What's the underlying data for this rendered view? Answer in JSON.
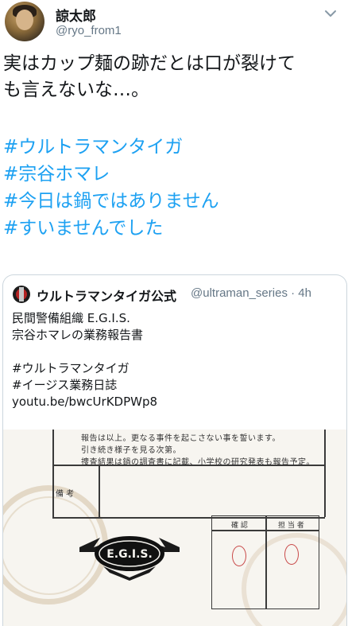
{
  "author": {
    "name": "諒太郎",
    "handle": "@ryo_from1"
  },
  "tweet": {
    "lines": [
      "実はカップ麺の跡だとは口が裂けて",
      "も言えないな…。"
    ],
    "hashtags": [
      "#ウルトラマンタイガ",
      "#宗谷ホマレ",
      "#今日は鍋ではありません",
      "#すいませんでした"
    ]
  },
  "quoted_tweet": {
    "name": "ウルトラマンタイガ公式",
    "handle_time": "@ultraman_series · 4h",
    "lines": [
      "民間警備組織 E.G.I.S.",
      "宗谷ホマレの業務報告書",
      "",
      "#ウルトラマンタイガ",
      "#イージス業務日誌",
      "youtu.be/bwcUrKDPWp8"
    ]
  },
  "document": {
    "handwriting": [
      "報告は以上。更なる事件を起こさない事を誓います。",
      "引き続き様子を見る次第。",
      "捜査結果は鍋の調査書に記載、小学校の研究発表も報告予定。"
    ],
    "remarks_label": "備 考",
    "logo_text": "E.G.I.S.",
    "box_labels": [
      "確 認",
      "担 当 者"
    ]
  },
  "icons": {
    "more": "chevron-down-icon",
    "avatar": "user-avatar",
    "quoted_avatar": "ultraman-avatar"
  }
}
